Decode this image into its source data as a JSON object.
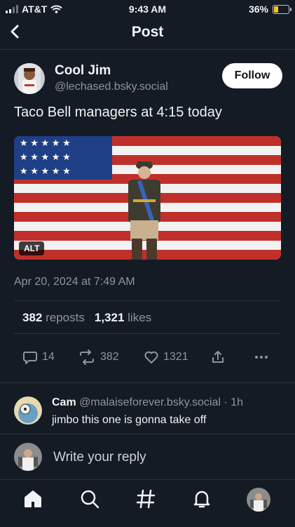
{
  "status_bar": {
    "carrier": "AT&T",
    "time": "9:43 AM",
    "battery": "36%",
    "battery_level": 0.36
  },
  "nav": {
    "title": "Post"
  },
  "post": {
    "author": {
      "name": "Cool Jim",
      "handle": "@lechased.bsky.social"
    },
    "follow_label": "Follow",
    "text": "Taco Bell managers at 4:15 today",
    "media": {
      "alt_badge": "ALT"
    },
    "timestamp": "Apr 20, 2024 at 7:49 AM",
    "stats": {
      "reposts_count": "382",
      "reposts_label": "reposts",
      "likes_count": "1,321",
      "likes_label": "likes"
    },
    "actions": {
      "replies": "14",
      "reposts": "382",
      "likes": "1321"
    }
  },
  "reply": {
    "author": "Cam",
    "handle": "@malaiseforever.bsky.social",
    "time": "· 1h",
    "text": "jimbo this one is gonna take off"
  },
  "composer": {
    "placeholder": "Write your reply"
  },
  "colors": {
    "background": "#141b24",
    "muted": "#8a96a3",
    "divider": "#2b333e",
    "battery": "#f5c518"
  },
  "tabs": [
    "home-icon",
    "search-icon",
    "hashtag-icon",
    "notifications-icon",
    "profile-avatar"
  ]
}
